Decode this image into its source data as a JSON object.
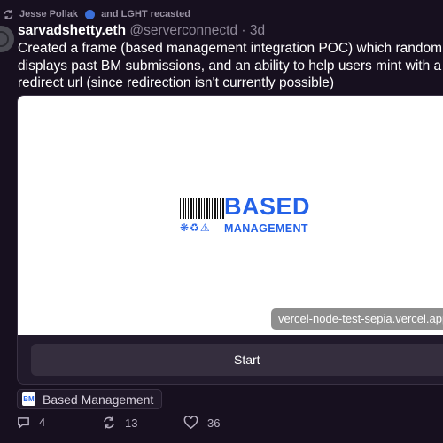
{
  "recast": {
    "user": "Jesse Pollak",
    "others": "and LGHT recasted"
  },
  "post": {
    "display_name": "sarvadshetty.eth",
    "handle": "@serverconnectd",
    "time": "· 3d",
    "text": "Created a frame (based management integration POC) which randomly displays past BM submissions, and an ability to help users mint with a redirect url (since redirection isn't currently possible)"
  },
  "frame": {
    "logo_title": "BASED",
    "logo_icons": "❋♻⚠",
    "logo_subtitle": "MANAGEMENT",
    "url": "vercel-node-test-sepia.vercel.app",
    "button_label": "Start"
  },
  "channel": {
    "name": "Based Management",
    "icon_text": "BM"
  },
  "actions": {
    "replies": "4",
    "recasts": "13",
    "likes": "36"
  },
  "icons": {
    "recast": "recast-icon",
    "reply": "reply-icon",
    "like": "heart-icon"
  },
  "colors": {
    "background": "#17101f",
    "brand_blue": "#2462e8",
    "muted_text": "#8e8898"
  }
}
